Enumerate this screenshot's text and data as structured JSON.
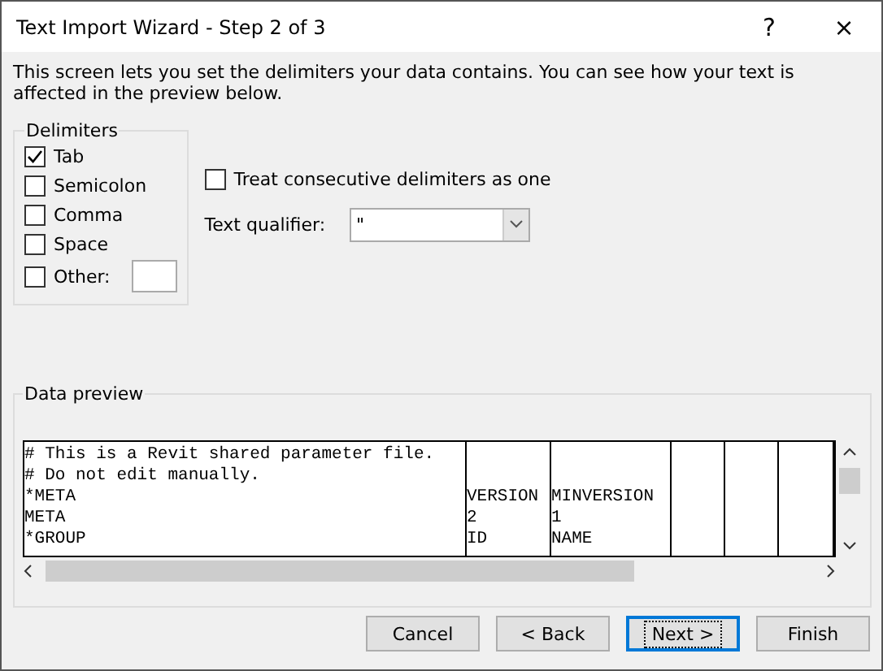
{
  "window": {
    "title": "Text Import Wizard - Step 2 of 3",
    "help": "?",
    "close": "×"
  },
  "description": "This screen lets you set the delimiters your data contains.  You can see how your text is affected in the preview below.",
  "delimiters": {
    "title": "Delimiters",
    "items": [
      {
        "label": "Tab",
        "checked": true
      },
      {
        "label": "Semicolon",
        "checked": false
      },
      {
        "label": "Comma",
        "checked": false
      },
      {
        "label": "Space",
        "checked": false
      },
      {
        "label": "Other:",
        "checked": false,
        "kind": "other"
      }
    ]
  },
  "consecutive": {
    "label": "Treat consecutive delimiters as one",
    "checked": false
  },
  "qualifier": {
    "label": "Text qualifier:",
    "value": "\""
  },
  "preview": {
    "title": "Data preview",
    "rows": [
      [
        "# This is a Revit shared parameter file.",
        "",
        ""
      ],
      [
        "# Do not edit manually.",
        "",
        ""
      ],
      [
        "*META",
        "VERSION",
        "MINVERSION"
      ],
      [
        "META",
        "2",
        "1"
      ],
      [
        "*GROUP",
        "ID",
        "NAME"
      ]
    ]
  },
  "buttons": [
    {
      "label": "Cancel",
      "focused": false
    },
    {
      "label": "< Back",
      "focused": false
    },
    {
      "label": "Next >",
      "focused": true
    },
    {
      "label": "Finish",
      "focused": false
    }
  ]
}
